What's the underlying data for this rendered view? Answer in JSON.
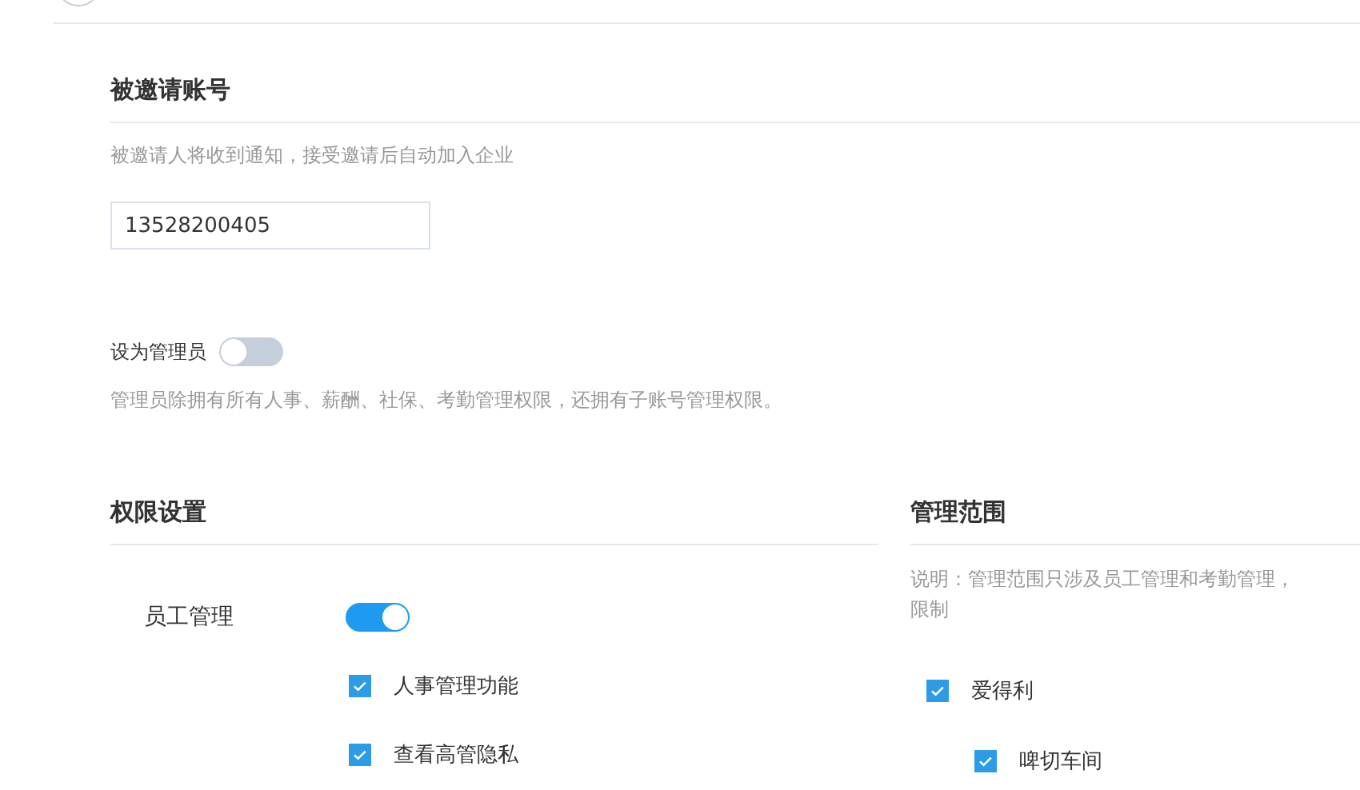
{
  "invite": {
    "title": "被邀请账号",
    "hint": "被邀请人将收到通知，接受邀请后自动加入企业",
    "account": "13528200405"
  },
  "admin": {
    "label": "设为管理员",
    "on": false,
    "note": "管理员除拥有所有人事、薪酬、社保、考勤管理权限，还拥有子账号管理权限。"
  },
  "permissions": {
    "title": "权限设置",
    "groups": [
      {
        "label": "员工管理",
        "on": true,
        "options": [
          {
            "label": "人事管理功能",
            "checked": true
          },
          {
            "label": "查看高管隐私",
            "checked": true
          }
        ]
      }
    ]
  },
  "scope": {
    "title": "管理范围",
    "note_lines": [
      "说明：管理范围只涉及员工管理和考勤管理，",
      "限制"
    ],
    "items": [
      {
        "label": "爱得利",
        "checked": true,
        "children": [
          {
            "label": "啤切车间",
            "checked": true
          }
        ]
      }
    ]
  }
}
